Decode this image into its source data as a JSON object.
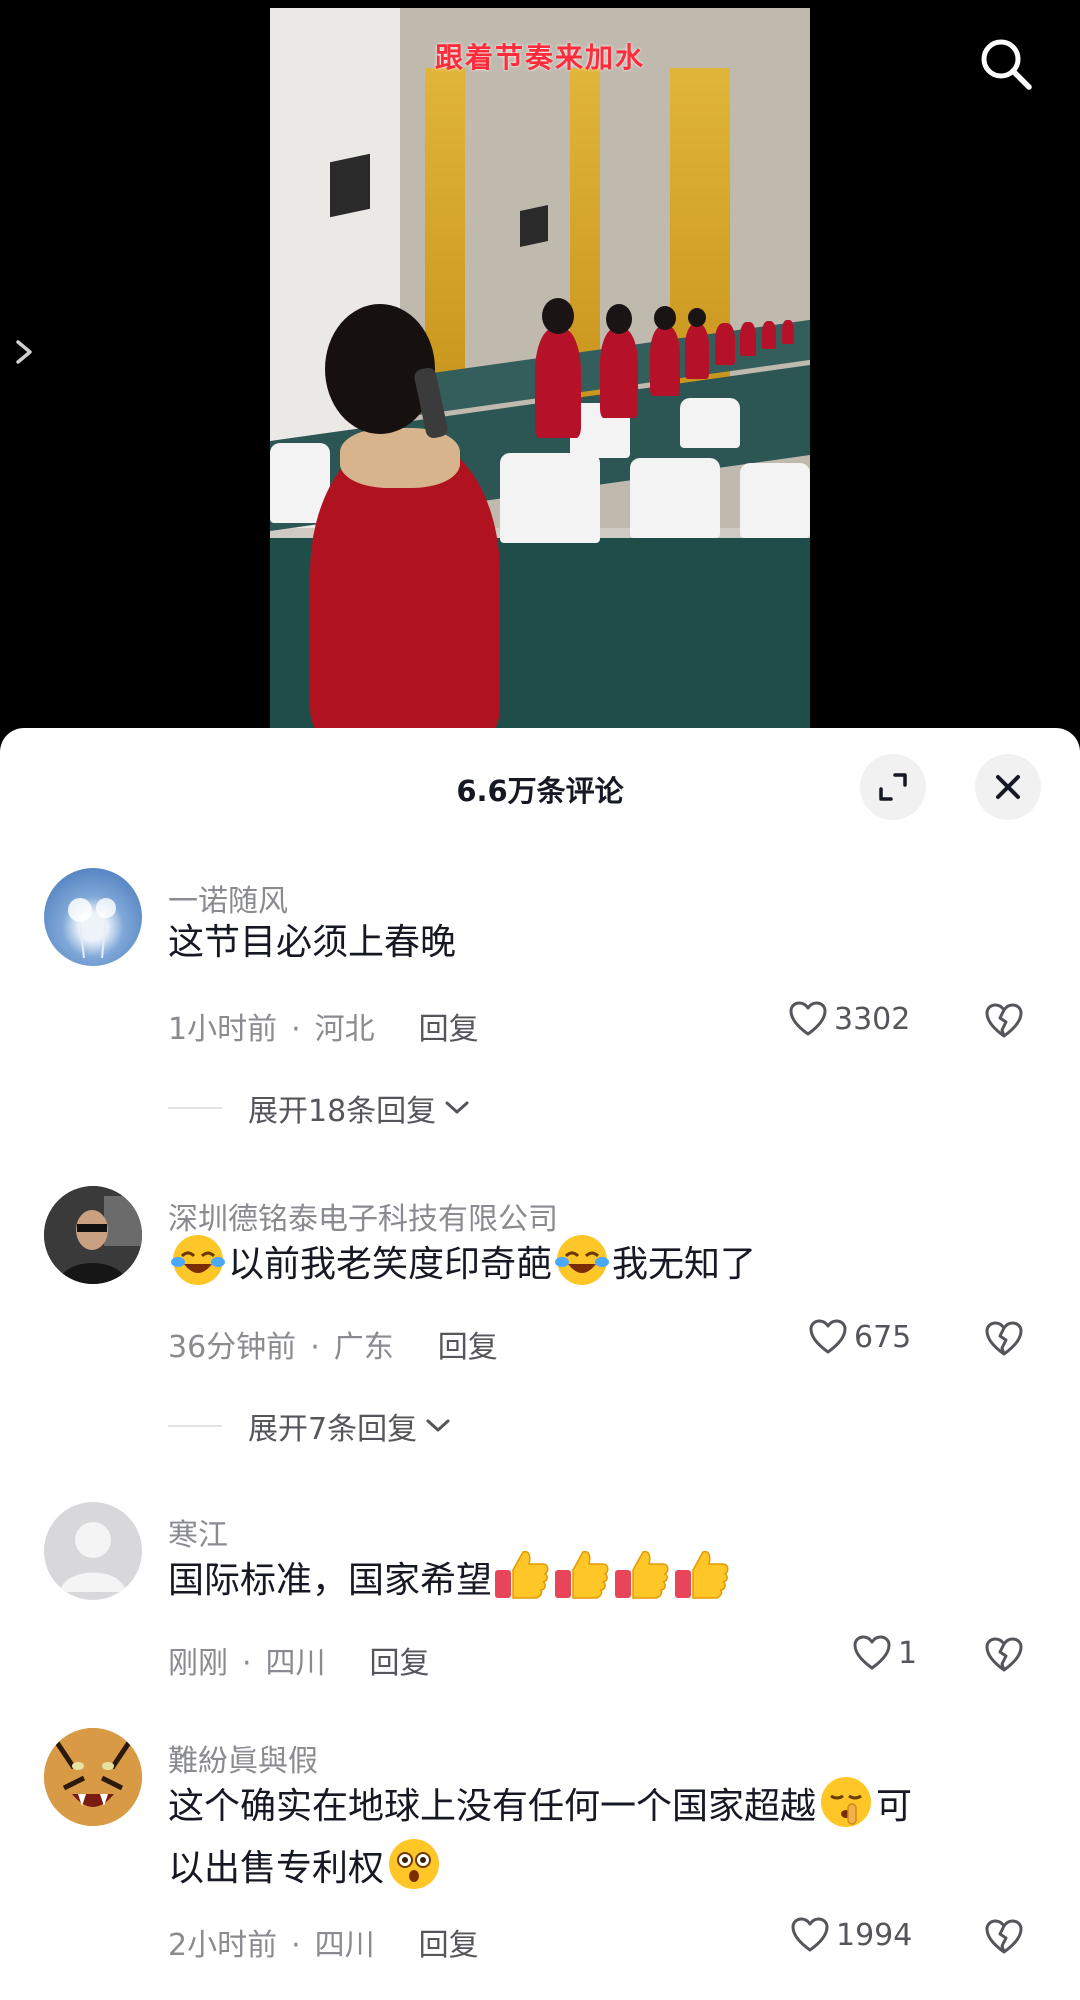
{
  "video": {
    "caption": "跟着节奏来加水"
  },
  "sheet": {
    "title": "6.6万条评论"
  },
  "comments": [
    {
      "username": "一诺随风",
      "text": "这节目必须上春晚",
      "time": "1小时前",
      "location": "河北",
      "reply_label": "回复",
      "likes": "3302",
      "expand_label": "展开18条回复"
    },
    {
      "username": "深圳德铭泰电子科技有限公司",
      "text_parts": [
        "以前我老笑度印奇葩",
        "我无知了"
      ],
      "time": "36分钟前",
      "location": "广东",
      "reply_label": "回复",
      "likes": "675",
      "expand_label": "展开7条回复"
    },
    {
      "username": "寒江",
      "text": "国际标准，国家希望",
      "time": "刚刚",
      "location": "四川",
      "reply_label": "回复",
      "likes": "1"
    },
    {
      "username": "難紛眞與假",
      "text_line1": "这个确实在地球上没有任何一个国家超越",
      "text_line1_end": "可",
      "text_line2": "以出售专利权",
      "time": "2小时前",
      "location": "四川",
      "reply_label": "回复",
      "likes": "1994"
    }
  ],
  "icons": {
    "search": "search-icon",
    "back": "chevron-right-icon",
    "expand": "expand-icon",
    "close": "close-icon",
    "like": "heart-outline-icon",
    "dislike": "broken-heart-icon"
  },
  "colors": {
    "sheet_bg": "#ffffff",
    "secondary_text": "#8a8b91",
    "primary_text": "#161823",
    "caption": "#ff2d3c"
  }
}
